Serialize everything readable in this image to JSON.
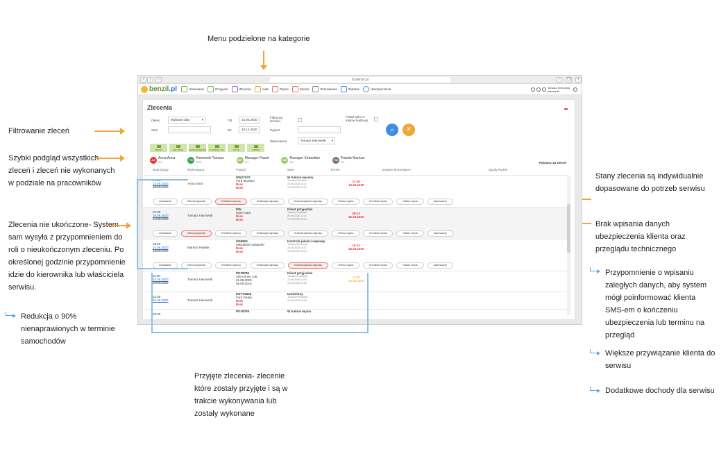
{
  "annotations": {
    "top": "Menu podzielone na kategorie",
    "filter": "Filtrowanie zleceń",
    "preview": "Szybki podgląd wszystkich zleceń i zleceń nie wykonanych w podziale na pracowników",
    "unfinished": "Zlecenia nie ukończone- System sam wysyła z przypomnieniem do roli o nieukończonym zleceniu. Po określonej godzinie przypomnienie idzie do kierownika lub właściciela serwisu.",
    "reduction": "Redukcja o 90% nienaprawionych w terminie samochodów",
    "accepted": "Przyjęte zlecenia- zlecenie które zostały przyjęte i są w trakcie wykonywania lub zostały wykonane",
    "states": "Stany zlecenia są indywidualnie dopasowane do potrzeb serwisu",
    "missing": "Brak wpisania danych ubezpieczenia klienta oraz przeglądu technicznego",
    "reminder": "Przypomnienie o wpisaniu zaległych danych, aby system mógł poinformować klienta SMS-em o kończeniu ubezpieczenia lub terminu na przegląd",
    "binding": "Większe przywiązanie klienta do serwisu",
    "income": "Dodatkowe dochody dla serwisu"
  },
  "browser": {
    "url": "ib.benzil.pl"
  },
  "app": {
    "logo_main": "benzil",
    "logo_suffix": ".pl",
    "menu": [
      "Umawianie",
      "Przyjęcie",
      "Zlecenia",
      "Auta",
      "Opinie",
      "Serwis",
      "Zamówienia",
      "Zadania",
      "Ubezpieczenia"
    ],
    "user": "Tomasz Kierownik kierownik"
  },
  "page": {
    "title": "Zlecenia",
    "filters": {
      "okres_label": "Okres",
      "okres_value": "Wybrane daty",
      "od_label": "Od",
      "od_value": "14.05.2020",
      "do_label": "Do",
      "do_value": "10.12.2020",
      "stan_label": "Stan",
      "filtruj_label": "Filtruj wg terminu",
      "pokaz_label": "Pokaż tylko w trakcie realizacji",
      "pojazd_label": "Pojazd",
      "wykonawca_label": "Wykonawca",
      "wykonawca_value": "Tomasz Kierownik"
    },
    "categories": [
      "UMAWIA",
      "PRZYJĘCIE",
      "NAPRAWA/SERWIS",
      "KONTROLA JAK.",
      "MYCIE",
      "ODBIÓR"
    ],
    "workers": [
      {
        "initials": "AA",
        "name": "Anna Anna",
        "count": "1/1",
        "color": "#e53935"
      },
      {
        "initials": "TK",
        "name": "Kierownik Tomasz",
        "count": "2/22",
        "color": "#43a047"
      },
      {
        "initials": "MP",
        "name": "Manager Paweł",
        "count": "1/1",
        "color": "#9ccc65"
      },
      {
        "initials": "MS",
        "name": "Manager Sebastian",
        "count": "1/1",
        "color": "#9ccc65"
      },
      {
        "initials": "PM",
        "name": "Pawluk Mariusz",
        "count": "1/1",
        "color": "#8d6e63"
      }
    ],
    "count": "Pobrano 14 zleceń",
    "columns": [
      "Data wizyty",
      "Wykonawca",
      "Pojazd",
      "Start",
      "Termin",
      "Ostatnie komentarze",
      "Zgody RODO"
    ],
    "statuses": [
      "Umawianie",
      "Klient przyjechał",
      "W trakcie wyceny",
      "Realizacja naprawy",
      "Kontrola jakości naprawy",
      "Telefon mycia",
      "W trakcie mycia",
      "Odbiór mycia",
      "Zakończony"
    ],
    "rows": [
      {
        "time": "07:30",
        "date1": "13.05.2020",
        "date2": "60/05/2020",
        "worker": "Anna Anna",
        "plate": "DW2Y072",
        "car": "Ford Mondeo",
        "ins": "Brak",
        "insp": "Brak",
        "status": "W trakcie wyceny",
        "who": "Tomasz Kierownik",
        "d1": "24.06.2020 11:21",
        "d2": "13.05.2020 11:00",
        "t1": "11:00",
        "t2": "13.05.2020",
        "active": 2
      },
      {
        "time": "07:30",
        "date1": "15.06.2020",
        "date2": "61/06/2020",
        "worker": "Tomasz Kierownik",
        "plate": "DW",
        "car": "Opel Astra",
        "ins": "Brak",
        "insp": "Brak",
        "status": "Klient przyjechał",
        "who": "Tomasz Kierownik",
        "d1": "24.06.2020 11:21",
        "d2": "24.06.2020 09:14",
        "t1": "09:23",
        "t2": "15.06.2020",
        "active": 1
      },
      {
        "time": "15:20",
        "date1": "15.06.2020",
        "date2": "62/06/2020",
        "worker": "Mariusz Pawluk",
        "plate": "GD6824",
        "car": "Mitsubishi Outlander",
        "ins": "Brak",
        "insp": "Brak",
        "status": "Kontrola jakości naprawy",
        "who": "Tomasz Kierownik",
        "d1": "24.06.2020 11:37",
        "d2": "16.06.2020 16:21",
        "t1": "16:21",
        "t2": "15.06.2020",
        "active": 4
      },
      {
        "time": "11:00",
        "date1": "24.06.2020",
        "date2": "64/06/2020",
        "worker": "Tomasz Kierownik",
        "plate": "PO78789",
        "car": "Alfa romeo 146",
        "ins": "21.08.2020",
        "insp": "05.09.2018",
        "status": "Klient przyjechał",
        "who": "Tomasz Kierownik",
        "d1": "24.06.2020 10:53",
        "d2": "24.06.2020 10:56",
        "t1": "14:00",
        "t2": "24.06.2020"
      },
      {
        "time": "13:30",
        "date1": "25.06.2020",
        "date2": "",
        "worker": "Tomasz Kierownik",
        "plate": "KRTY5666",
        "car": "Ford Fiesta",
        "ins": "Brak",
        "insp": "Brak",
        "status": "Umówiony",
        "who": "Tomasz Kierownik",
        "d1": "24.06.2020 10:53",
        "d2": "",
        "t1": "",
        "t2": ""
      },
      {
        "time": "10:30",
        "date1": "",
        "date2": "",
        "worker": "",
        "plate": "PO78789",
        "car": "",
        "ins": "",
        "insp": "",
        "status": "W trakcie mycia",
        "who": "",
        "d1": "",
        "d2": "",
        "t1": "",
        "t2": ""
      }
    ]
  },
  "colors": {
    "accent": "#f2a33c",
    "frame": "#8cc0ea",
    "brand_green": "#7cb342",
    "brand_blue": "#2e6ec6"
  }
}
